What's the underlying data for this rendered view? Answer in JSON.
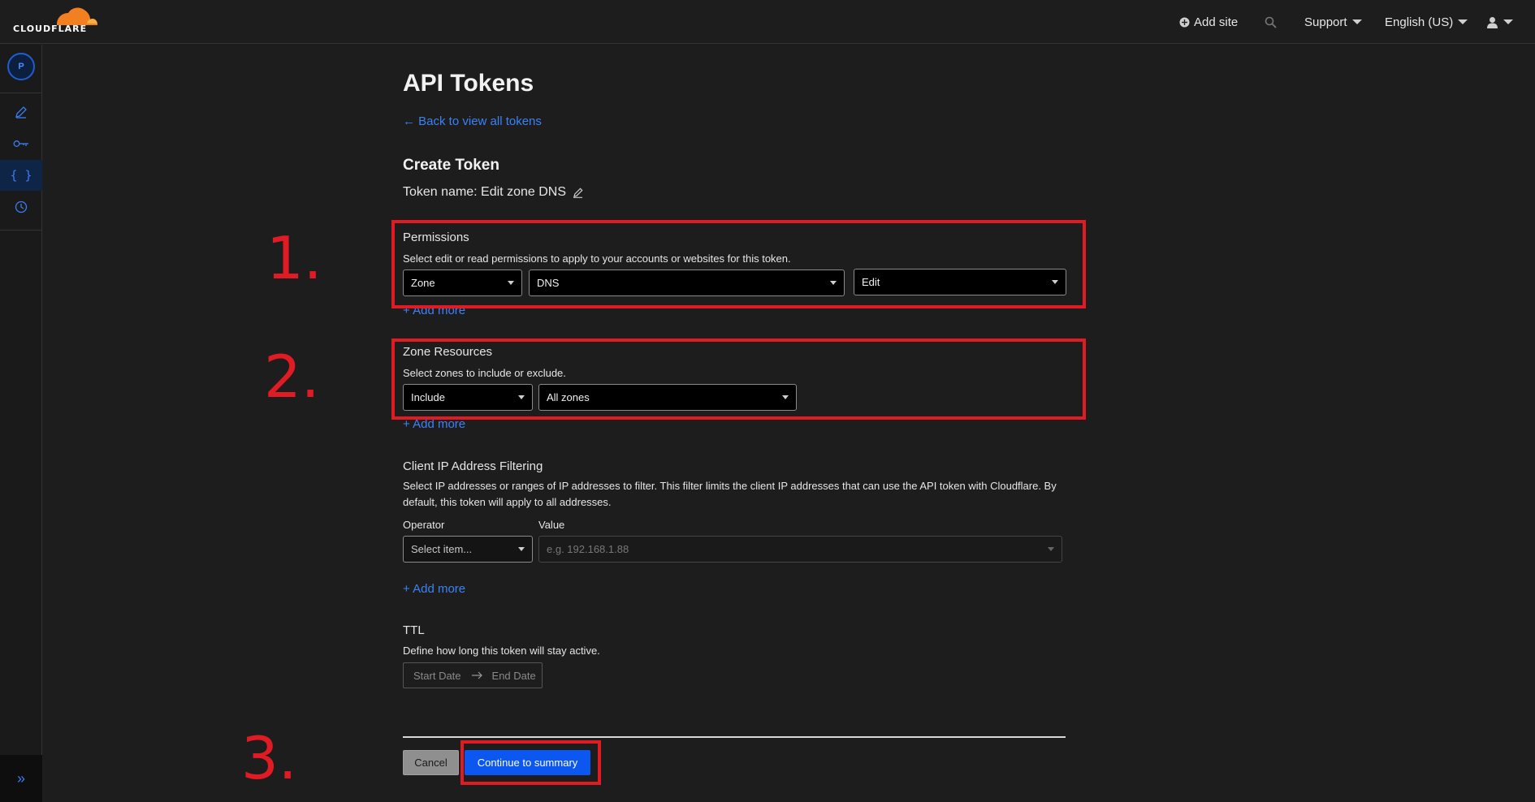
{
  "topbar": {
    "logo_text": "CLOUDFLARE",
    "add_site": "Add site",
    "support": "Support",
    "language": "English (US)"
  },
  "sidebar": {
    "avatar_initial": "P",
    "items": [
      {
        "icon": "pencil-icon"
      },
      {
        "icon": "key-icon"
      },
      {
        "icon": "braces-icon",
        "active": true
      },
      {
        "icon": "clock-icon"
      }
    ],
    "expand_icon": "double-chevron-right-icon"
  },
  "page": {
    "title": "API Tokens",
    "back_link": "← Back to view all tokens",
    "section_title": "Create Token",
    "token_name": "Token name: Edit zone DNS"
  },
  "permissions": {
    "title": "Permissions",
    "description": "Select edit or read permissions to apply to your accounts or websites for this token.",
    "selects": [
      "Zone",
      "DNS",
      "Edit"
    ],
    "add_more": "+ Add more"
  },
  "zone_resources": {
    "title": "Zone Resources",
    "description": "Select zones to include or exclude.",
    "selects": [
      "Include",
      "All zones"
    ],
    "add_more": "+ Add more"
  },
  "ip_filtering": {
    "title": "Client IP Address Filtering",
    "description": "Select IP addresses or ranges of IP addresses to filter. This filter limits the client IP addresses that can use the API token with Cloudflare. By default, this token will apply to all addresses.",
    "operator_label": "Operator",
    "operator_placeholder": "Select item...",
    "value_label": "Value",
    "value_placeholder": "e.g. 192.168.1.88",
    "add_more": "+ Add more"
  },
  "ttl": {
    "title": "TTL",
    "description": "Define how long this token will stay active.",
    "start_placeholder": "Start Date",
    "end_placeholder": "End Date"
  },
  "actions": {
    "cancel": "Cancel",
    "continue": "Continue to summary"
  },
  "annotations": {
    "step1": "1.",
    "step2": "2.",
    "step3": "3."
  },
  "colors": {
    "accent": "#3b82f6",
    "primary_button": "#0b57f0",
    "annotation": "#e01b24",
    "logo_orange": "#f38020"
  }
}
